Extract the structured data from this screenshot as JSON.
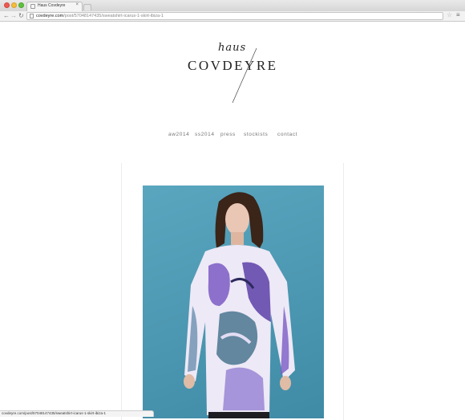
{
  "browser": {
    "tab_title": "Haus Covdeyre",
    "tab_close": "×",
    "url_host": "covdeyre.com",
    "url_path": "/post/57048147435/sweatshirt-icarus-1-skirt-ibiza-1",
    "status_url": "covdeyre.com/post/57048147435/sweatshirt-icarus-1-skirt-ibiza-1"
  },
  "header": {
    "logo_script": "haus",
    "logo_text": "COVDEYRE"
  },
  "nav": {
    "items": [
      {
        "label": "aw2014"
      },
      {
        "label": "ss2014"
      },
      {
        "label": "press"
      },
      {
        "label": "stockists"
      },
      {
        "label": "contact"
      }
    ]
  },
  "post": {
    "image_alt": "Model wearing printed sweatshirt Icarus 1"
  },
  "colors": {
    "photo_background": "#4d98b2",
    "sweatshirt_purple": "#7b5bc4"
  },
  "icons": {
    "back": "arrow-left-icon",
    "forward": "arrow-right-icon",
    "reload": "reload-icon",
    "star": "star-icon",
    "menu": "hamburger-menu-icon"
  }
}
